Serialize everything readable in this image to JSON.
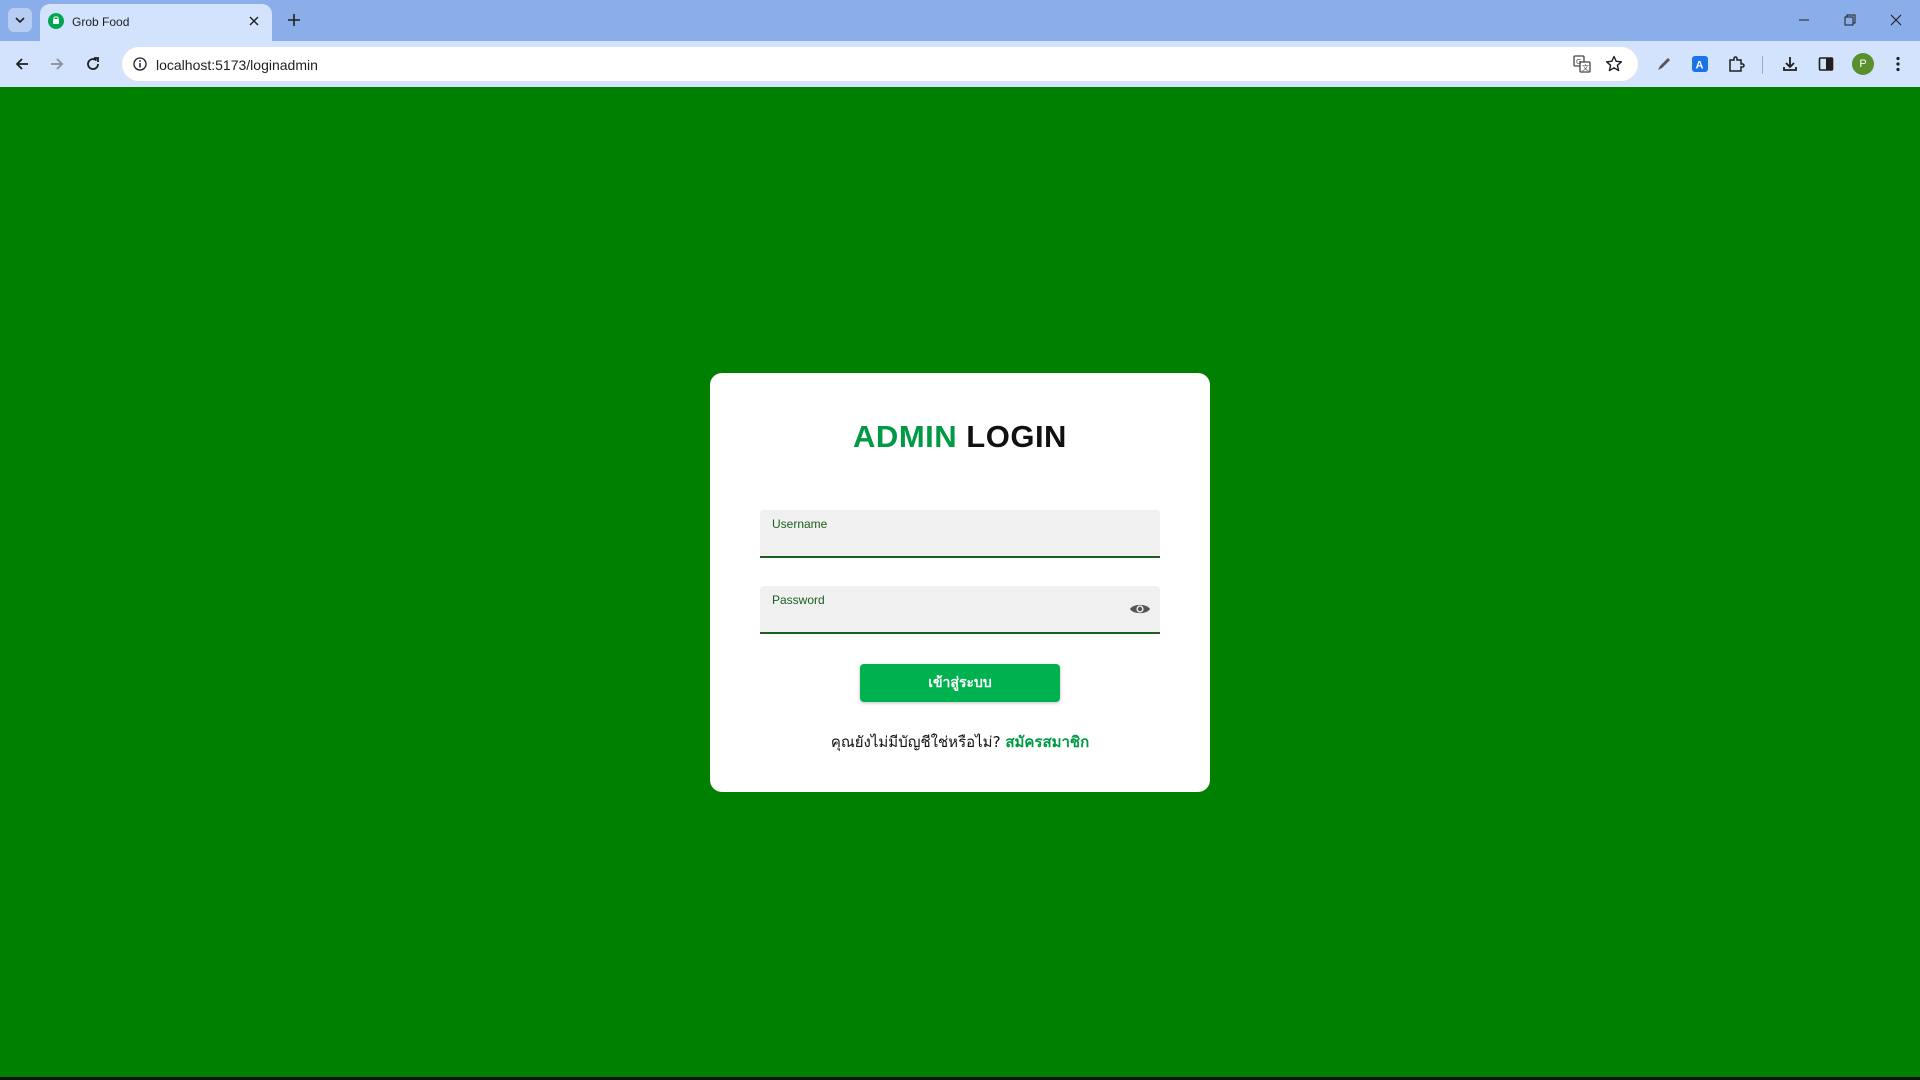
{
  "browser": {
    "tab_title": "Grob Food",
    "url": "localhost:5173/loginadmin",
    "profile_initial": "P"
  },
  "login": {
    "title_accent": "ADMIN",
    "title_rest": "LOGIN",
    "username_label": "Username",
    "username_value": "",
    "password_label": "Password",
    "password_value": "",
    "submit_label": "เข้าสู่ระบบ",
    "signup_prompt": "คุณยังไม่มีบัญชีใช่หรือไม่?",
    "signup_link": "สมัครสมาชิก"
  },
  "colors": {
    "page_background": "#008000",
    "accent": "#009944",
    "button": "#00b14f"
  },
  "icons": [
    "tab-search-icon",
    "favicon-icon",
    "close-icon",
    "plus-icon",
    "minimize-icon",
    "restore-icon",
    "window-close-icon",
    "back-arrow-icon",
    "forward-arrow-icon",
    "reload-icon",
    "info-icon",
    "translate-icon",
    "star-icon",
    "pen-icon",
    "extension-a-icon",
    "puzzle-icon",
    "download-icon",
    "sidepanel-icon",
    "kebab-menu-icon",
    "eye-icon"
  ]
}
